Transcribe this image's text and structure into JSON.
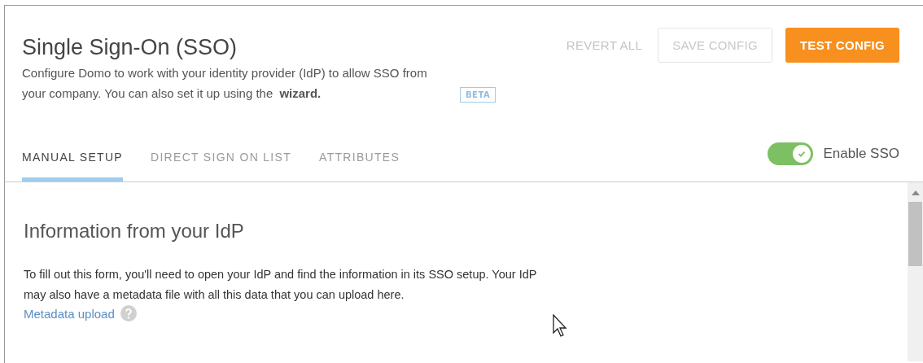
{
  "header": {
    "title": "Single Sign-On (SSO)",
    "description": "Configure Domo to work with your identity provider (IdP) to allow SSO from your company. You can also set it up using the",
    "link": "wizard.",
    "badge": "BETA"
  },
  "buttons": [
    {
      "label": "REVERT ALL",
      "kind": "text"
    },
    {
      "label": "SAVE CONFIG",
      "kind": "outline"
    },
    {
      "label": "TEST CONFIG",
      "kind": "primary"
    }
  ],
  "tabs": [
    {
      "label": "MANUAL SETUP",
      "selected": true
    },
    {
      "label": "DIRECT SIGN ON LIST",
      "selected": false
    },
    {
      "label": "ATTRIBUTES",
      "selected": false
    }
  ],
  "toggle": {
    "label": "Enable SSO",
    "on": true
  },
  "section": {
    "heading": "Information from your IdP",
    "body": "To fill out this form, you'll need to open your IdP and find the information in its SSO setup. Your IdP may also have a metadata file with all this data that you can upload here.",
    "link": "Metadata upload"
  }
}
